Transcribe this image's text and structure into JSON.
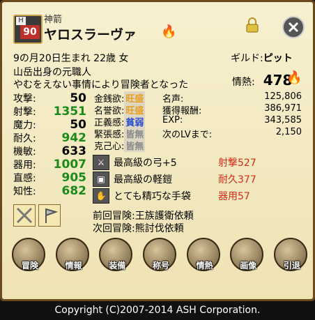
{
  "character": {
    "level_prefix": "H",
    "level": "90",
    "title": "神箭",
    "name": "ヤロスラーヴァ",
    "birth": "9の月20日生まれ 22歳 女",
    "origin": "山岳出身の元職人",
    "reason": "やむをえない事情により冒険者となった",
    "guild_label": "ギルド:",
    "guild": "ピット",
    "passion_label": "情熱:",
    "passion": "478"
  },
  "stats": [
    {
      "label": "攻撃:",
      "value": "50",
      "color": "#000000"
    },
    {
      "label": "射撃:",
      "value": "1351",
      "color": "#1a8a1a"
    },
    {
      "label": "魔力:",
      "value": "50",
      "color": "#000000"
    },
    {
      "label": "耐久:",
      "value": "942",
      "color": "#1a8a1a"
    },
    {
      "label": "機敏:",
      "value": "633",
      "color": "#000000"
    },
    {
      "label": "器用:",
      "value": "1007",
      "color": "#1a8a1a"
    },
    {
      "label": "直感:",
      "value": "905",
      "color": "#1a8a1a"
    },
    {
      "label": "知性:",
      "value": "682",
      "color": "#1a8a1a"
    }
  ],
  "desires": [
    {
      "label": "金銭欲:",
      "value": "旺盛",
      "color": "#e8a020",
      "bg": "#dcd6c2"
    },
    {
      "label": "名誉欲:",
      "value": "旺盛",
      "color": "#e8a020",
      "bg": "#dcd6c2"
    },
    {
      "label": "正義感:",
      "value": "貧弱",
      "color": "#2a4ad0",
      "bg": "#dcd6c2"
    },
    {
      "label": "緊張感:",
      "value": "皆無",
      "color": "#888888",
      "bg": "#dcd6c2"
    },
    {
      "label": "克己心:",
      "value": "皆無",
      "color": "#888888",
      "bg": "#dcd6c2"
    }
  ],
  "records": [
    {
      "label": "名声:",
      "value": "125,806"
    },
    {
      "label": "獲得報酬:",
      "value": "386,971"
    },
    {
      "label": "EXP:",
      "value": "343,585"
    },
    {
      "label": "次のLVまで:",
      "value": "2,150"
    }
  ],
  "equipment": [
    {
      "icon": "bow-icon",
      "name": "最高級の弓+5",
      "stat": "射撃527"
    },
    {
      "icon": "armor-icon",
      "name": "最高級の軽鎧",
      "stat": "耐久377"
    },
    {
      "icon": "glove-icon",
      "name": "とても精巧な手袋",
      "stat": "器用57"
    }
  ],
  "adventure": {
    "prev": "前回冒険:王族護衛依頼",
    "next": "次回冒険:熊討伐依頼"
  },
  "menu": [
    {
      "label": "冒険"
    },
    {
      "label": "情報"
    },
    {
      "label": "装備"
    },
    {
      "label": "称号"
    },
    {
      "label": "情熱"
    },
    {
      "label": "画像"
    },
    {
      "label": "引退"
    }
  ],
  "footer": "Copyright (C)2007-2014 ASH Corporation."
}
